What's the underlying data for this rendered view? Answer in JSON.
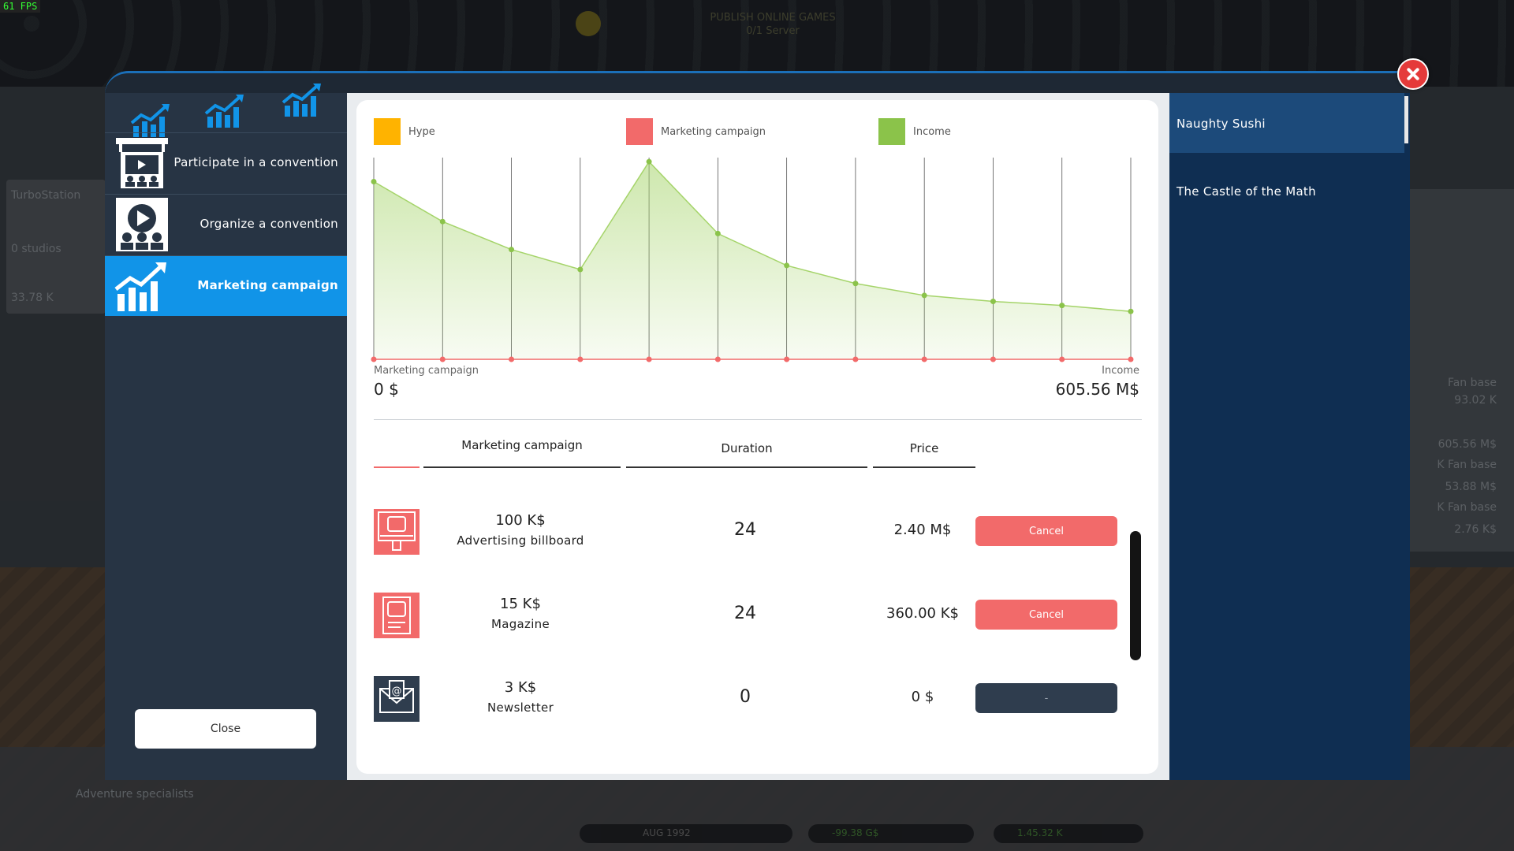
{
  "fps": "61 FPS",
  "background": {
    "top_title": "PUBLISH ONLINE GAMES",
    "top_subtitle": "0/1 Server",
    "left_card_name": "TurboStation",
    "left_card_studios": "0 studios",
    "left_card_value": "33.78 K",
    "right_values": [
      "Fan base",
      "93.02 K",
      "605.56 M$",
      "K Fan base",
      "53.88 M$",
      "K Fan base",
      "2.76 K$"
    ],
    "bottom_list": [
      "Adventure specialists"
    ],
    "bottom_date": "AUG 1992",
    "bottom_money": "-99.38 G$",
    "bottom_fans": "1.45.32 K"
  },
  "tabs": [
    {
      "icon": "trend-chart-icon"
    },
    {
      "icon": "trend-chart-icon"
    },
    {
      "icon": "trend-chart-icon"
    }
  ],
  "menu": [
    {
      "label": "Participate in a convention",
      "icon": "convention-booth-icon"
    },
    {
      "label": "Organize a convention",
      "icon": "organize-convention-icon"
    },
    {
      "label": "Marketing campaign",
      "icon": "marketing-chart-icon",
      "active": true
    }
  ],
  "close_button": "Close",
  "games": [
    {
      "name": "Naughty Sushi",
      "selected": true
    },
    {
      "name": "The Castle of the Math",
      "selected": false
    }
  ],
  "legend": [
    {
      "label": "Hype",
      "color": "#ffb300"
    },
    {
      "label": "Marketing campaign",
      "color": "#f26a6a"
    },
    {
      "label": "Income",
      "color": "#8bc34a"
    }
  ],
  "chart_data": {
    "type": "area",
    "x": [
      1,
      2,
      3,
      4,
      5,
      6,
      7,
      8,
      9,
      10,
      11,
      12
    ],
    "series": [
      {
        "name": "Income",
        "color": "#8bc34a",
        "values": [
          0.89,
          0.69,
          0.55,
          0.45,
          0.99,
          0.63,
          0.47,
          0.38,
          0.32,
          0.29,
          0.27,
          0.24
        ]
      },
      {
        "name": "Marketing campaign",
        "color": "#f26a6a",
        "values": [
          0,
          0,
          0,
          0,
          0,
          0,
          0,
          0,
          0,
          0,
          0,
          0
        ]
      }
    ],
    "ylim": [
      0,
      1.05
    ],
    "grid": "vertical"
  },
  "summary": {
    "left_label": "Marketing campaign",
    "left_value": "0 $",
    "right_label": "Income",
    "right_value": "605.56 M$"
  },
  "table": {
    "headers": {
      "campaign": "Marketing campaign",
      "duration": "Duration",
      "price": "Price"
    },
    "rows": [
      {
        "amount": "100 K$",
        "name": "Advertising billboard",
        "duration": "24",
        "price": "2.40 M$",
        "button": "Cancel",
        "icon": "billboard-icon",
        "state": "active"
      },
      {
        "amount": "15 K$",
        "name": "Magazine",
        "duration": "24",
        "price": "360.00 K$",
        "button": "Cancel",
        "icon": "magazine-icon",
        "state": "active"
      },
      {
        "amount": "3 K$",
        "name": "Newsletter",
        "duration": "0",
        "price": "0 $",
        "button": "-",
        "icon": "newsletter-icon",
        "state": "inactive"
      }
    ]
  }
}
